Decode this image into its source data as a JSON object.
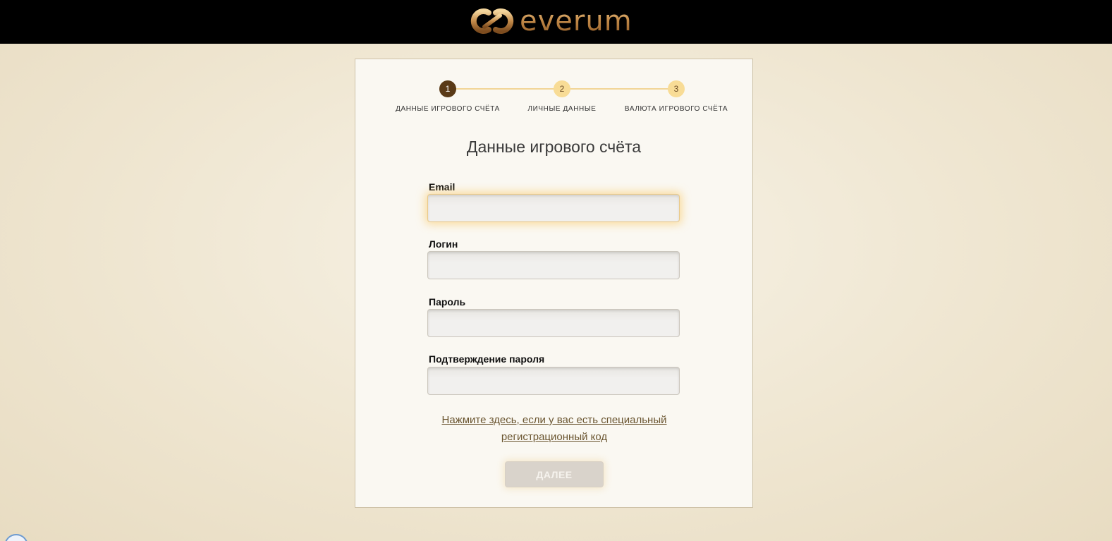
{
  "header": {
    "brand_name": "everum"
  },
  "stepper": {
    "steps": [
      {
        "number": "1",
        "label": "ДАННЫЕ ИГРОВОГО СЧЁТА",
        "state": "active"
      },
      {
        "number": "2",
        "label": "ЛИЧНЫЕ ДАННЫЕ",
        "state": "pending"
      },
      {
        "number": "3",
        "label": "ВАЛЮТА ИГРОВОГО СЧЁТА",
        "state": "pending"
      }
    ]
  },
  "form": {
    "title": "Данные игрового счёта",
    "fields": [
      {
        "label": "Email",
        "value": "",
        "focused": true
      },
      {
        "label": "Логин",
        "value": ""
      },
      {
        "label": "Пароль",
        "value": ""
      },
      {
        "label": "Подтверждение пароля",
        "value": ""
      }
    ],
    "promo_link": "Нажмите здесь, если у вас есть специальный регистрационный код",
    "next_button": "ДАЛЕЕ"
  },
  "colors": {
    "header_bg": "#000000",
    "brand_gold": "#c48b4a",
    "step_active": "#5a3a17",
    "step_pending": "#f8dc96",
    "focus_glow": "#fac45a",
    "button_disabled": "#d9d3cb"
  }
}
